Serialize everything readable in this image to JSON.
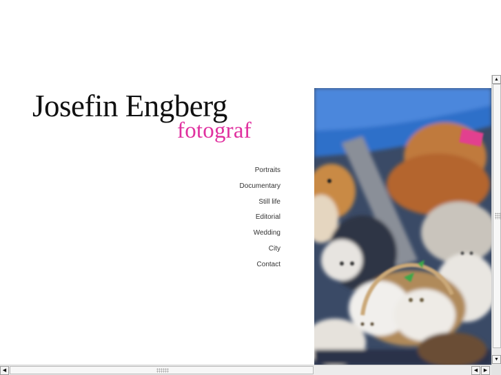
{
  "brand": {
    "name": "Josefin Engberg",
    "subtitle": "fotograf",
    "subtitle_color": "#e0309f"
  },
  "nav": {
    "items": [
      {
        "label": "Portraits"
      },
      {
        "label": "Documentary"
      },
      {
        "label": "Still life"
      },
      {
        "label": "Editorial"
      },
      {
        "label": "Wedding"
      },
      {
        "label": "City"
      },
      {
        "label": "Contact"
      }
    ]
  },
  "scrollbars": {
    "up_arrow": "▲",
    "down_arrow": "▼",
    "left_arrow": "◀",
    "right_arrow": "▶"
  }
}
